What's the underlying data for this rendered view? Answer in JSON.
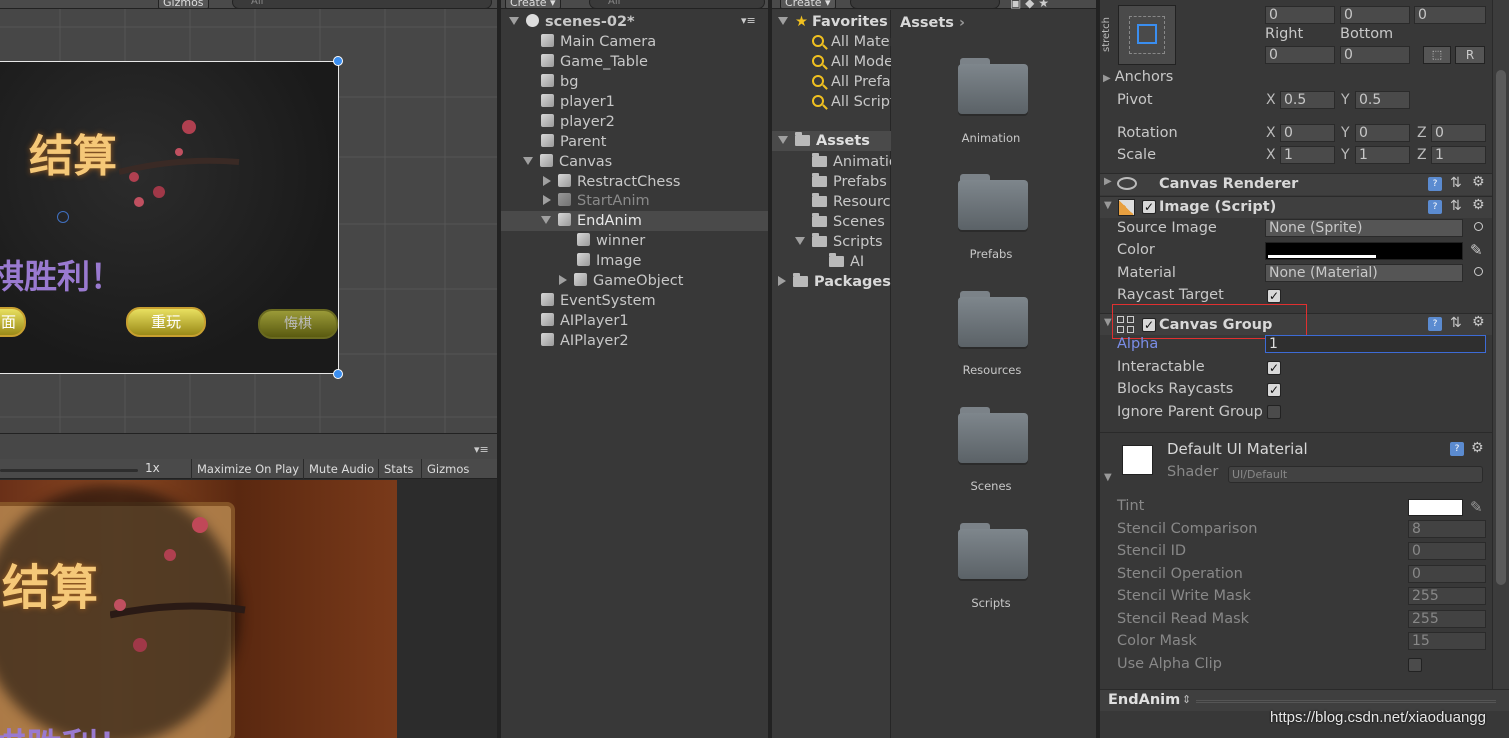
{
  "scene_view": {
    "toolbar": {
      "gizmos_label": "Gizmos",
      "search_placeholder": "All"
    },
    "title_text": "结算",
    "win_text": "棋胜利！",
    "buttons": [
      "面",
      "重玩",
      "悔棋"
    ]
  },
  "game_view": {
    "scale_value": "1x",
    "toolbar_buttons": [
      "Maximize On Play",
      "Mute Audio",
      "Stats",
      "Gizmos"
    ],
    "title_text": "结算",
    "win_text": "棋胜利！"
  },
  "hierarchy": {
    "create_label": "Create",
    "search_placeholder": "All",
    "scene_name": "scenes-02*",
    "items": [
      {
        "label": "Main Camera"
      },
      {
        "label": "Game_Table"
      },
      {
        "label": "bg"
      },
      {
        "label": "player1"
      },
      {
        "label": "player2"
      },
      {
        "label": "Parent"
      },
      {
        "label": "Canvas"
      },
      {
        "label": "RestractChess"
      },
      {
        "label": "StartAnim"
      },
      {
        "label": "EndAnim"
      },
      {
        "label": "winner"
      },
      {
        "label": "Image"
      },
      {
        "label": "GameObject"
      },
      {
        "label": "EventSystem"
      },
      {
        "label": "AIPlayer1"
      },
      {
        "label": "AIPlayer2"
      }
    ]
  },
  "project": {
    "create_label": "Create",
    "favorites_label": "Favorites",
    "favorites": [
      "All Materials",
      "All Models",
      "All Prefabs",
      "All Scripts"
    ],
    "assets_label": "Assets",
    "asset_folders": [
      "Animation",
      "Prefabs",
      "Resources",
      "Scenes",
      "Scripts"
    ],
    "ai_label": "AI",
    "packages_label": "Packages",
    "breadcrumb": "Assets",
    "grid_items": [
      "Animation",
      "Prefabs",
      "Resources",
      "Scenes",
      "Scripts"
    ]
  },
  "inspector": {
    "stretch_label": "stretch",
    "top_values": [
      "0",
      "0",
      "0"
    ],
    "right_label": "Right",
    "bottom_label": "Bottom",
    "rb_values": [
      "0",
      "0"
    ],
    "r_button": "R",
    "anchors_label": "Anchors",
    "pivot": {
      "label": "Pivot",
      "x": "0.5",
      "y": "0.5"
    },
    "rotation": {
      "label": "Rotation",
      "x": "0",
      "y": "0",
      "z": "0"
    },
    "scale": {
      "label": "Scale",
      "x": "1",
      "y": "1",
      "z": "1"
    },
    "axis": {
      "x": "X",
      "y": "Y",
      "z": "Z"
    },
    "canvas_renderer": "Canvas Renderer",
    "image_script": {
      "title": "Image (Script)",
      "source_image_label": "Source Image",
      "source_image_value": "None (Sprite)",
      "color_label": "Color",
      "material_label": "Material",
      "material_value": "None (Material)",
      "raycast_label": "Raycast Target"
    },
    "canvas_group": {
      "title": "Canvas Group",
      "alpha_label": "Alpha",
      "alpha_value": "1",
      "interactable_label": "Interactable",
      "blocks_label": "Blocks Raycasts",
      "ignore_label": "Ignore Parent Group"
    },
    "material": {
      "title": "Default UI Material",
      "shader_label": "Shader",
      "shader_value": "UI/Default",
      "tint_label": "Tint",
      "rows": [
        {
          "label": "Stencil Comparison",
          "value": "8"
        },
        {
          "label": "Stencil ID",
          "value": "0"
        },
        {
          "label": "Stencil Operation",
          "value": "0"
        },
        {
          "label": "Stencil Write Mask",
          "value": "255"
        },
        {
          "label": "Stencil Read Mask",
          "value": "255"
        },
        {
          "label": "Color Mask",
          "value": "15"
        },
        {
          "label": "Use Alpha Clip",
          "value": ""
        }
      ]
    },
    "footer_object": "EndAnim",
    "highlight_color": "#e03030",
    "alpha_focus_color": "#3d6bd6"
  },
  "watermark": "https://blog.csdn.net/xiaoduangg"
}
